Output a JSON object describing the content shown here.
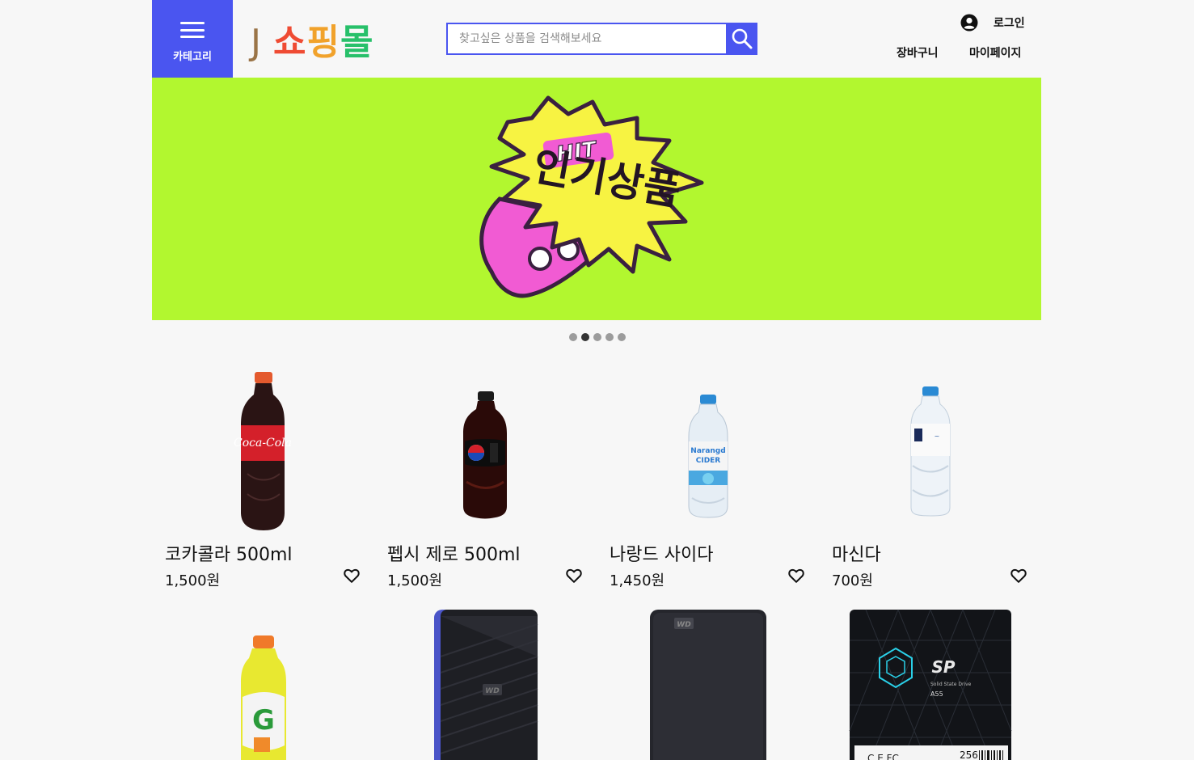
{
  "header": {
    "category_label": "카테고리",
    "logo": {
      "j": "J",
      "part1": "쇼",
      "part2": "핑",
      "part3": "몰"
    },
    "search_placeholder": "찾고싶은 상품을 검색해보세요",
    "login_label": "로그인",
    "cart_label": "장바구니",
    "mypage_label": "마이페이지"
  },
  "banner": {
    "badge_small": "HIT",
    "badge_main": "인기상품",
    "bg_color": "#b2f72f",
    "slides": 5,
    "active_slide": 2
  },
  "products": [
    {
      "name": "코카콜라 500ml",
      "price": "1,500원",
      "image": "coca-cola-bottle"
    },
    {
      "name": "펩시 제로 500ml",
      "price": "1,500원",
      "image": "pepsi-zero-bottle"
    },
    {
      "name": "나랑드 사이다",
      "price": "1,450원",
      "image": "narangd-cider-bottle"
    },
    {
      "name": "마신다",
      "price": "700원",
      "image": "water-bottle"
    },
    {
      "name": "",
      "price": "",
      "image": "gatorade-bottle"
    },
    {
      "name": "",
      "price": "",
      "image": "wd-external-hdd-blue"
    },
    {
      "name": "",
      "price": "",
      "image": "wd-elements-hdd-black"
    },
    {
      "name": "",
      "price": "",
      "image": "sp-a55-ssd"
    }
  ],
  "ssd_label": {
    "brand": "SP",
    "line1": "Solid State Drive",
    "model": "A55",
    "capacity": "256"
  },
  "colors": {
    "accent": "#4a55f0",
    "logo_j": "#9a7447",
    "logo_1": "#ef4b33",
    "logo_2": "#f1a22b",
    "logo_3": "#27c06a"
  }
}
